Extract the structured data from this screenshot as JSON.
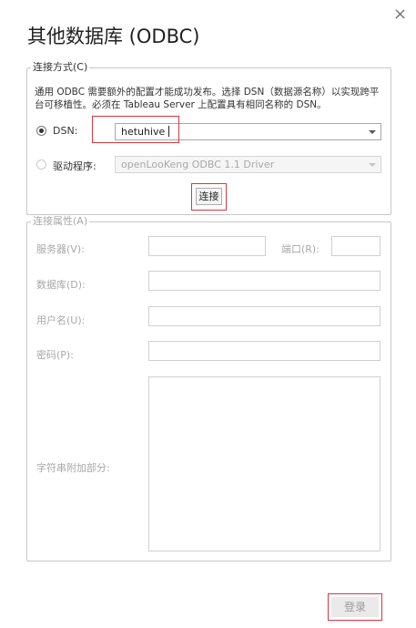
{
  "dialog": {
    "title": "其他数据库 (ODBC)",
    "close_glyph": "×"
  },
  "connection_method": {
    "legend": "连接方式(C)",
    "description": "通用 ODBC 需要额外的配置才能成功发布。选择 DSN（数据源名称）以实现跨平台可移植性。必须在 Tableau Server 上配置具有相同名称的 DSN。",
    "dsn_label": "DSN:",
    "dsn_value": "hetuhive",
    "dsn_selected": true,
    "driver_label": "驱动程序:",
    "driver_value": "openLooKeng ODBC 1.1 Driver",
    "driver_selected": false,
    "connect_button": "连接"
  },
  "connection_properties": {
    "legend": "连接属性(A)",
    "server_label": "服务器(V):",
    "port_label": "端口(R):",
    "database_label": "数据库(D):",
    "username_label": "用户名(U):",
    "password_label": "密码(P):",
    "string_extras_label": "字符串附加部分:"
  },
  "footer": {
    "login_button": "登录"
  },
  "colors": {
    "highlight_red": "#d9363e",
    "disabled_text": "#a8a8a8"
  }
}
